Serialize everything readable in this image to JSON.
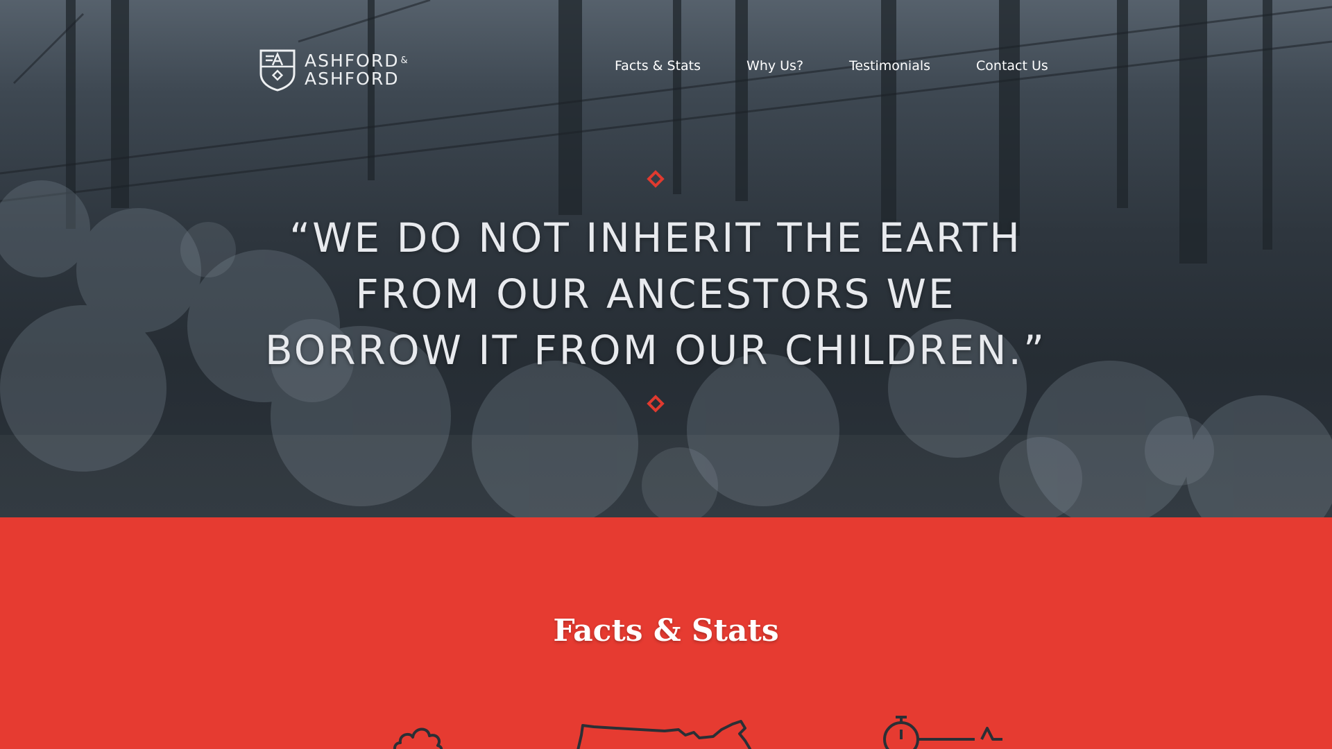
{
  "brand": {
    "line1": "ASHFORD",
    "line2": "ASHFORD",
    "amp": "&",
    "icon": "shield-logo-icon"
  },
  "nav": [
    {
      "label": "Facts & Stats"
    },
    {
      "label": "Why Us?"
    },
    {
      "label": "Testimonials"
    },
    {
      "label": "Contact Us"
    }
  ],
  "hero": {
    "quote_lines": [
      "“WE DO NOT INHERIT THE EARTH",
      "FROM OUR ANCESTORS WE",
      "BORROW IT FROM OUR CHILDREN.”"
    ],
    "accent_color": "#e03a2f"
  },
  "facts": {
    "title": "Facts & Stats",
    "background_color": "#e63b31",
    "icons": [
      "cloud-icon",
      "usa-map-icon",
      "stopwatch-icon"
    ]
  }
}
